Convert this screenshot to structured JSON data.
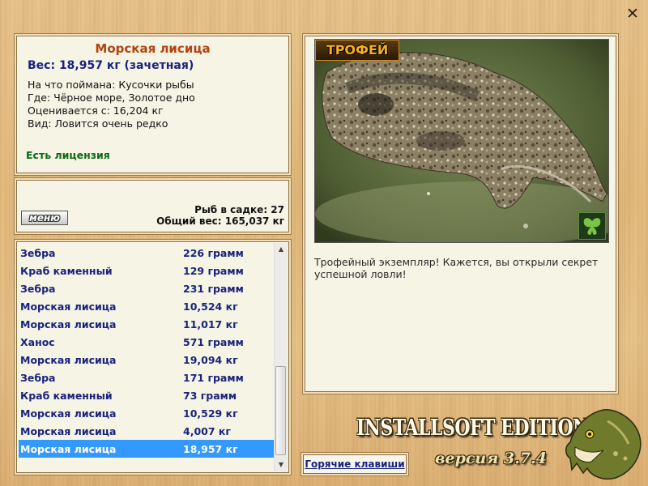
{
  "fish": {
    "name": "Морская лисица",
    "weight_line": "Вес: 18,957 кг (зачетная)",
    "bait_line": "На что поймана: Кусочки рыбы",
    "place_line": "Где: Чёрное море, Золотое дно",
    "valued_line": "Оценивается с: 16,204 кг",
    "kind_line": "Вид: Ловится очень редко",
    "license": "Есть лицензия"
  },
  "stats": {
    "menu_label": "меню",
    "fish_count": "Рыб в садке: 27",
    "total_weight": "Общий вес: 165,037 кг"
  },
  "catch_list": [
    {
      "name": "Зебра",
      "weight": "226 грамм"
    },
    {
      "name": "Краб каменный",
      "weight": "129 грамм"
    },
    {
      "name": "Зебра",
      "weight": "231 грамм"
    },
    {
      "name": "Морская лисица",
      "weight": "10,524 кг"
    },
    {
      "name": "Морская лисица",
      "weight": "11,017 кг"
    },
    {
      "name": "Ханос",
      "weight": "571 грамм"
    },
    {
      "name": "Морская лисица",
      "weight": "19,094 кг"
    },
    {
      "name": "Зебра",
      "weight": "171 грамм"
    },
    {
      "name": "Краб каменный",
      "weight": "73 грамм"
    },
    {
      "name": "Морская лисица",
      "weight": "10,529 кг"
    },
    {
      "name": "Морская лисица",
      "weight": "4,007 кг"
    },
    {
      "name": "Морская лисица",
      "weight": "18,957 кг",
      "selected": true
    }
  ],
  "trophy": {
    "badge": "ТРОФЕЙ",
    "caption": "Трофейный экземпляр! Кажется, вы открыли секрет успешной ловли!",
    "photo_icon": "butterfly-icon"
  },
  "footer": {
    "hotkeys": "Горячие клавиши",
    "brand": "INSTALLSOFT EDITION",
    "version": "версия 3.7.4"
  },
  "window": {
    "close_icon": "close-icon",
    "close_glyph": "✕"
  },
  "colors": {
    "title": "#b3420f",
    "list_text": "#1a237e",
    "selection": "#3399ff",
    "license": "#0b6b11"
  }
}
